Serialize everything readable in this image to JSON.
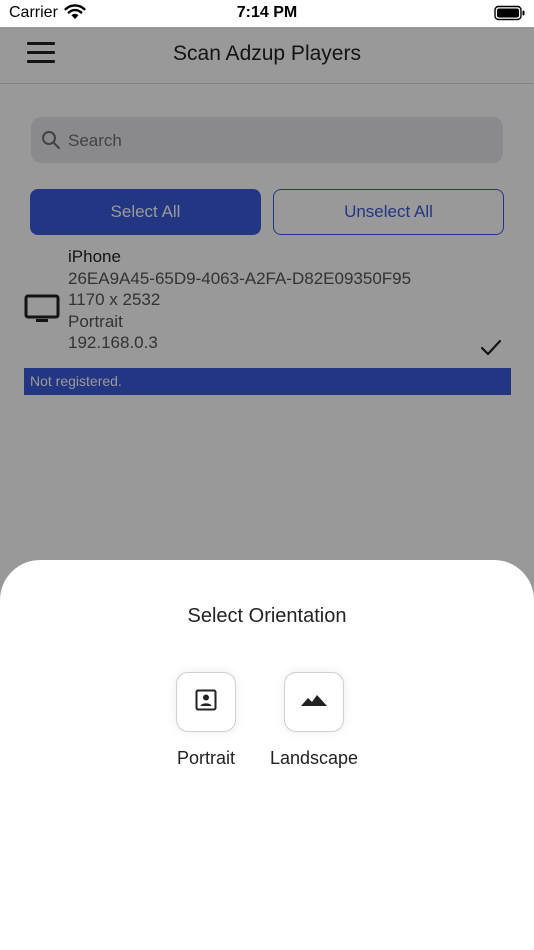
{
  "status_bar": {
    "carrier": "Carrier",
    "time": "7:14 PM"
  },
  "nav": {
    "title": "Scan Adzup Players",
    "menu_icon": "hamburger-menu-icon"
  },
  "search": {
    "placeholder": "Search",
    "value": "",
    "icon": "search-icon"
  },
  "actions": {
    "select_all_label": "Select All",
    "unselect_all_label": "Unselect All"
  },
  "players": [
    {
      "name": "iPhone",
      "id": "26EA9A45-65D9-4063-A2FA-D82E09350F95",
      "resolution": "1170 x 2532",
      "orientation": "Portrait",
      "ip": "192.168.0.3",
      "status": "Not registered.",
      "selected": true,
      "icon": "monitor-icon"
    }
  ],
  "sheet": {
    "title": "Select Orientation",
    "options": [
      {
        "label": "Portrait",
        "icon": "portrait-icon"
      },
      {
        "label": "Landscape",
        "icon": "landscape-icon"
      }
    ]
  },
  "colors": {
    "accent": "#3b5bdb",
    "overlay": "rgba(0,0,0,0.4)"
  }
}
